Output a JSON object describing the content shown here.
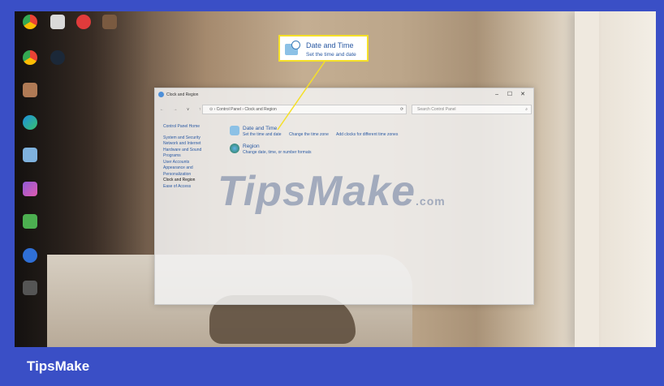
{
  "window": {
    "title": "Clock and Region",
    "controls": [
      "–",
      "☐",
      "✕"
    ],
    "nav_glyphs": "← → ∨ ↑",
    "breadcrumb": "⊙ › Control Panel › Clock and Region",
    "search_placeholder": "Search Control Panel"
  },
  "sidebar": {
    "home": "Control Panel Home",
    "items": [
      "System and Security",
      "Network and Internet",
      "Hardware and Sound",
      "Programs",
      "User Accounts",
      "Appearance and",
      "Personalization",
      "Clock and Region",
      "Ease of Access"
    ]
  },
  "categories": [
    {
      "title": "Date and Time",
      "links": [
        "Set the time and date",
        "Change the time zone",
        "Add clocks for different time zones"
      ]
    },
    {
      "title": "Region",
      "links": [
        "Change date, time, or number formats"
      ]
    }
  ],
  "callout": {
    "title": "Date and Time",
    "subtitle": "Set the time and date"
  },
  "watermark": {
    "main": "TipsMake",
    "suffix": ".com"
  },
  "footer": {
    "brand": "TipsMake"
  },
  "colors": {
    "frame": "#3a4fc6",
    "callout_border": "#f5e028",
    "link": "#2b5aa3"
  }
}
